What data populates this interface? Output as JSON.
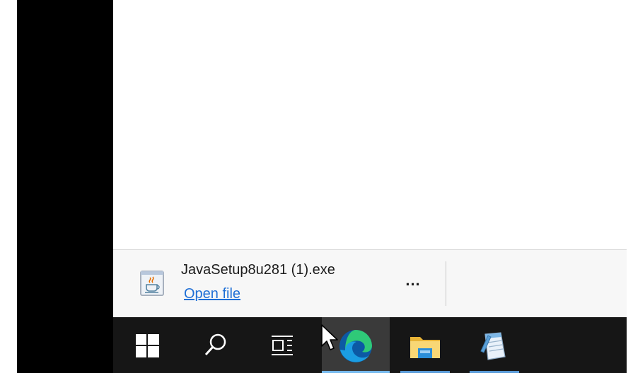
{
  "download_bar": {
    "file_name": "JavaSetup8u281 (1).exe",
    "open_file_label": "Open file",
    "more_label": "..."
  },
  "icons": {
    "download_file": "java-installer-icon",
    "start": "windows-logo-icon",
    "search": "search-icon",
    "task_view": "task-view-icon",
    "edge": "edge-browser-icon",
    "explorer": "file-explorer-icon",
    "notepad": "notepad-icon",
    "cursor": "mouse-pointer-icon"
  },
  "colors": {
    "taskbar": "#161616",
    "download_bar": "#f7f7f7",
    "link": "#1f6fd6",
    "running_indicator": "#76b9ed"
  }
}
